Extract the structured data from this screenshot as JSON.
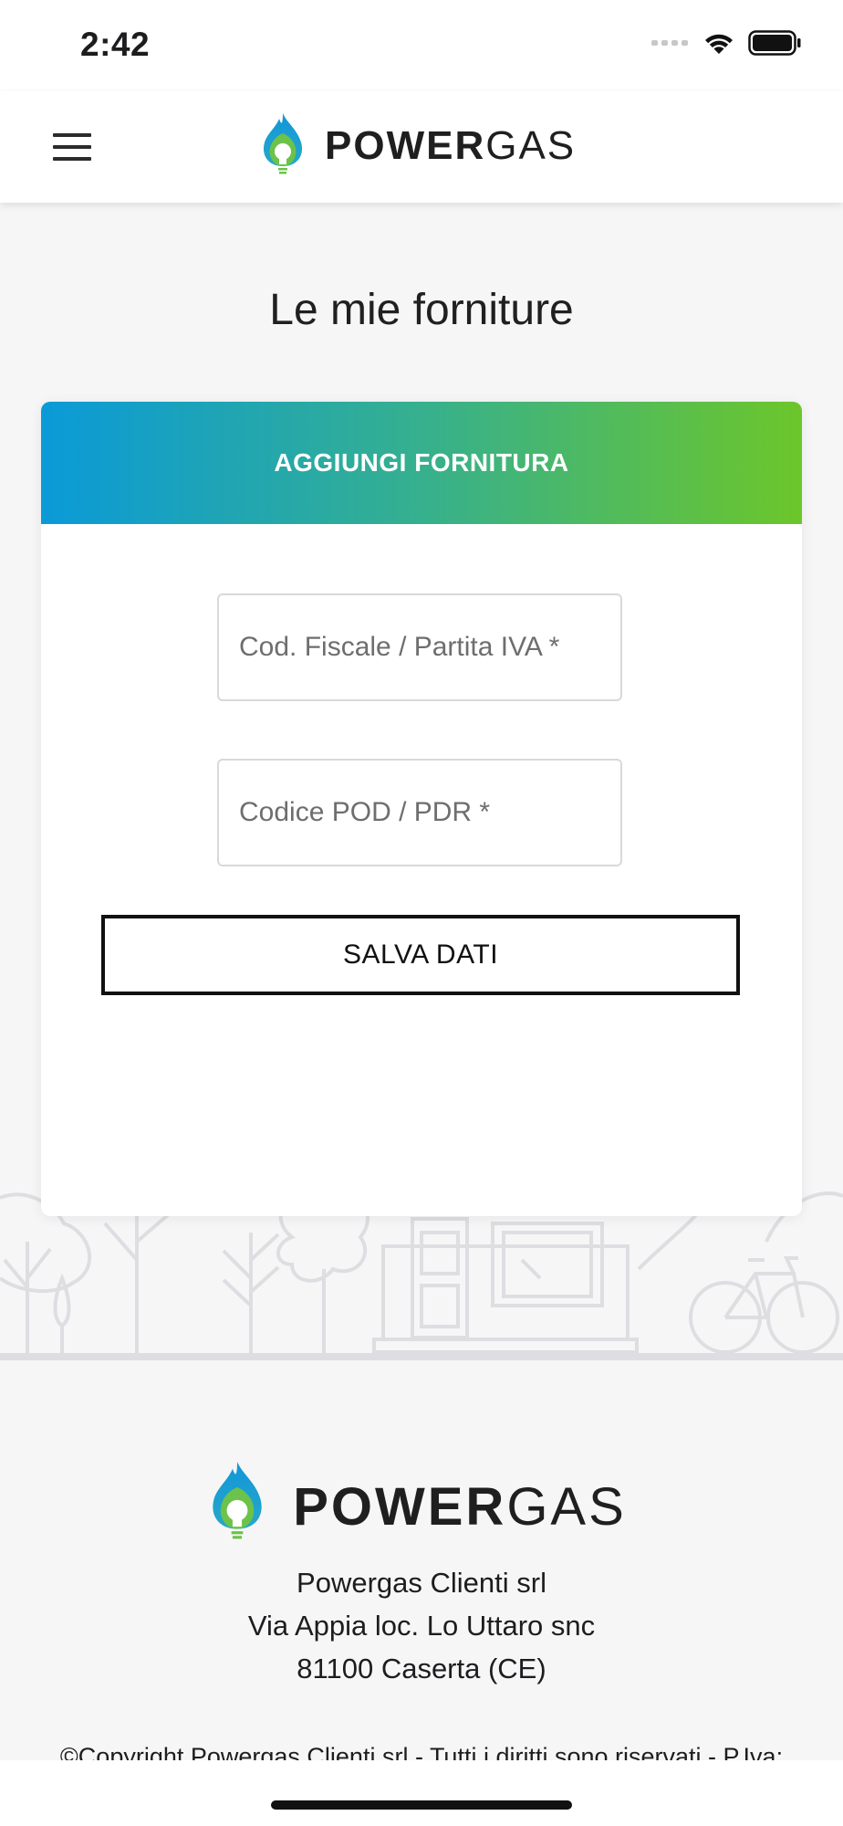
{
  "status_bar": {
    "time": "2:42"
  },
  "header": {
    "brand": {
      "bold": "POWER",
      "light": "GAS"
    },
    "icons": {
      "menu": "hamburger-menu-icon",
      "logo": "flame-bulb-logo"
    }
  },
  "page": {
    "title": "Le mie forniture"
  },
  "card": {
    "title": "AGGIUNGI FORNITURA",
    "fields": {
      "fiscal_code": {
        "placeholder": "Cod. Fiscale / Partita IVA *",
        "value": ""
      },
      "pod_pdr": {
        "placeholder": "Codice POD / PDR *",
        "value": ""
      }
    },
    "save_label": "SALVA DATI"
  },
  "footer": {
    "brand": {
      "bold": "POWER",
      "light": "GAS"
    },
    "company": "Powergas Clienti srl",
    "address": "Via Appia loc. Lo Uttaro snc",
    "city": "81100 Caserta (CE)",
    "copyright": "©Copyright Powergas Clienti srl - Tutti i diritti sono riservati - P.Iva:"
  },
  "colors": {
    "gradient_start": "#0a9ad8",
    "gradient_end": "#6cc62a",
    "page_background": "#f6f6f7"
  }
}
